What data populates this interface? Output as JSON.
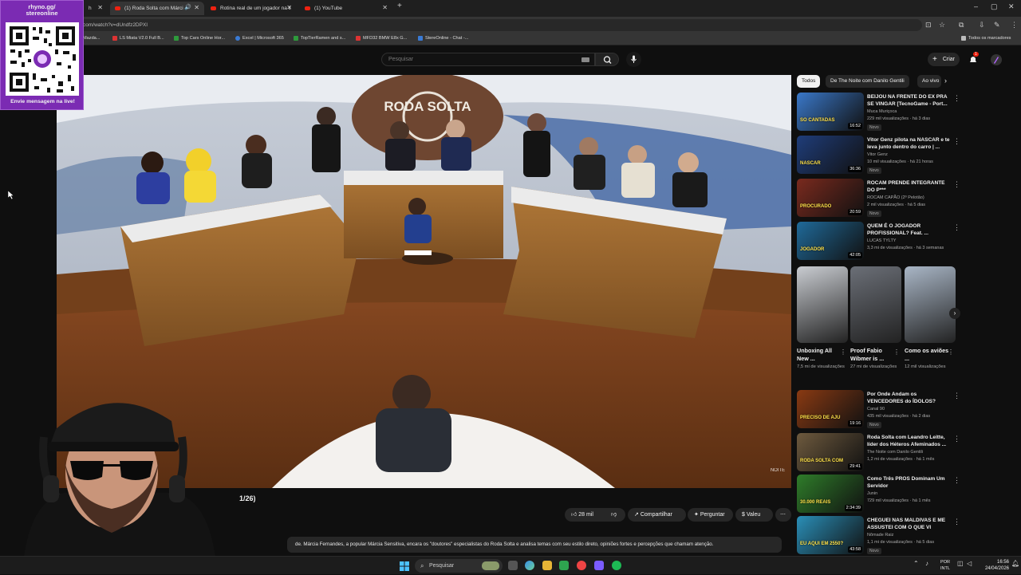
{
  "browser": {
    "tabs": [
      {
        "label": "h",
        "active": false
      },
      {
        "label": "(1) Roda Solta com Márci",
        "active": true
      },
      {
        "label": "Rotina real de um jogador na ll",
        "active": false
      },
      {
        "label": "(1) YouTube",
        "active": false
      }
    ],
    "url": "com/watch?v=dUndfz2DPXI",
    "bookmarks": [
      "Mazda...",
      "LS Miata V2.0 Full B...",
      "Top Cars Online Hor...",
      "Excel | Microsoft 365",
      "TopTierRamen and s...",
      "MFD32 BMW E8x G...",
      "StereOnline - Chat -..."
    ],
    "bookmarks_folder": "Todos os marcadores"
  },
  "youtube": {
    "search_placeholder": "Pesquisar",
    "create_label": "Criar",
    "notification_count": "1"
  },
  "video": {
    "title_fragment": "1/26)",
    "watermark": "NOITE",
    "set_logo": "RODA SOLTA",
    "likes": "28 mil",
    "share_label": "Compartilhar",
    "ask_label": "Perguntar",
    "thanks_label": "Valeu",
    "description": "de. Márcia Fernandes, a popular Márcia Sensitiva, encara os \"doutores\" especialistas do Roda Solta e analisa temas com seu estilo direto, opiniões fortes e percepções que chamam atenção."
  },
  "sidebar": {
    "chips": [
      "Todos",
      "De The Noite com Danilo Gentili",
      "Ao vivo"
    ],
    "recs_top": [
      {
        "title": "BEIJOU NA FRENTE DO EX PRA SE VINGAR [TecnoGame - Port...",
        "channel": "Muca Muriçoca",
        "meta": "229 mil visualizações · há 3 dias",
        "duration": "16:52",
        "badge": "Novo",
        "thumb_text": "SO CANTADAS",
        "thumb_color": "#3a78c9"
      },
      {
        "title": "Vitor Genz pilota na NASCAR e te leva junto dentro do carro | ...",
        "channel": "Vitor Genz",
        "meta": "10 mil visualizações · há 21 horas",
        "duration": "36:36",
        "badge": "Novo",
        "thumb_text": "NASCAR",
        "thumb_color": "#1f3d7a"
      },
      {
        "title": "ROCAM PRENDE INTEGRANTE DO P***",
        "channel": "ROCAM CAPÃO (2º Pelotão)",
        "meta": "2 mil visualizações · há 5 dias",
        "duration": "20:59",
        "badge": "Novo",
        "thumb_text": "PROCURADO",
        "thumb_color": "#7a2a1e"
      },
      {
        "title": "QUEM É O JOGADOR PROFISSIONAL? Feat. ...",
        "channel": "LUCAS TYLTY",
        "meta": "3,3 mi de visualizações · há 3 semanas",
        "duration": "42:05",
        "badge": "",
        "thumb_text": "JOGADOR",
        "thumb_color": "#1f6a9a"
      }
    ],
    "shorts": [
      {
        "title": "Unboxing All New ...",
        "views": "7,5 mi de visualizações",
        "color": "#c9ccd1"
      },
      {
        "title": "Proof Fabio Wibmer is ...",
        "views": "27 mi de visualizações",
        "color": "#6b6f77"
      },
      {
        "title": "Como os aviões ...",
        "views": "12 mil visualizações",
        "color": "#a9b6c6"
      }
    ],
    "recs_bottom": [
      {
        "title": "Por Onde Andam os VENCEDORES do ÍDOLOS?",
        "channel": "Canal 90",
        "meta": "435 mil visualizações · há 2 dias",
        "duration": "19:16",
        "badge": "Novo",
        "thumb_text": "PRECISO DE AJU",
        "thumb_color": "#8a3a12"
      },
      {
        "title": "Roda Solta com Leandro Leitte, líder dos Héteros Afeminados ...",
        "channel": "The Noite com Danilo Gentili",
        "meta": "1,2 mi de visualizações · há 1 mês",
        "duration": "29:41",
        "badge": "",
        "thumb_text": "RODA SOLTA COM",
        "thumb_color": "#6e5a3e"
      },
      {
        "title": "Como Três PROS Dominam Um Servidor",
        "channel": "Junin",
        "meta": "729 mil visualizações · há 1 mês",
        "duration": "2:34:39",
        "badge": "",
        "thumb_text": "30.000 REAIS",
        "thumb_color": "#2f7d2a"
      },
      {
        "title": "CHEGUEI NAS MALDIVAS E ME ASSUSTEI COM O QUE VI",
        "channel": "Nômade Raiz",
        "meta": "1,1 mi de visualizações · há 5 dias",
        "duration": "43:58",
        "badge": "Novo",
        "thumb_text": "EU AQUI EM 2550?",
        "thumb_color": "#2a8fb8"
      }
    ]
  },
  "overlay": {
    "url": "rhyno.gg/ stereonline",
    "cta": "Envie mensagem na live!"
  },
  "taskbar": {
    "search_label": "Pesquisar",
    "lang_top": "POR",
    "lang_bottom": "INTL",
    "time": "16:56",
    "date": "24/04/2026"
  }
}
